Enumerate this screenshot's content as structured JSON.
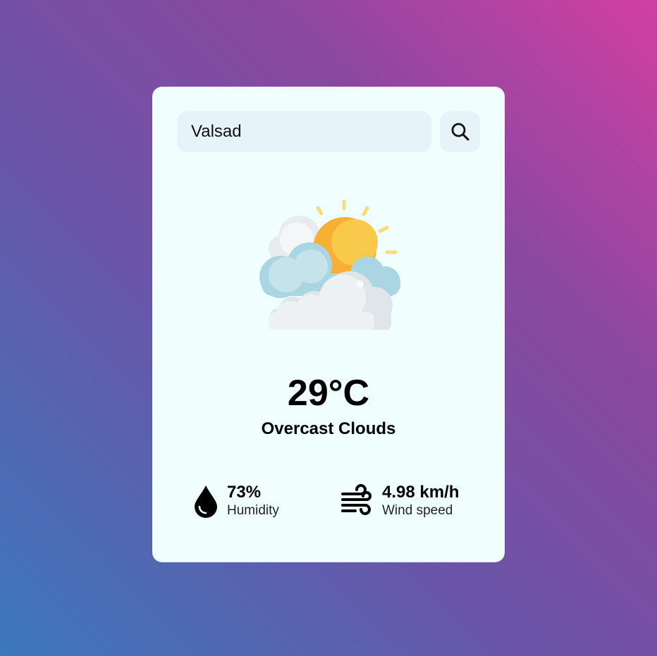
{
  "search": {
    "value": "Valsad",
    "button_icon": "search-icon"
  },
  "weather": {
    "icon": "partly-cloudy-sun-icon",
    "temperature": "29°C",
    "condition": "Overcast Clouds"
  },
  "details": {
    "humidity": {
      "icon": "water-drop-icon",
      "value": "73%",
      "label": "Humidity"
    },
    "wind": {
      "icon": "wind-icon",
      "value": "4.98 km/h",
      "label": "Wind speed"
    }
  },
  "colors": {
    "card_background": "#f0fefe",
    "input_background": "#e6f3f9",
    "gradient_start": "#3b78bd",
    "gradient_end": "#d23fa3"
  }
}
